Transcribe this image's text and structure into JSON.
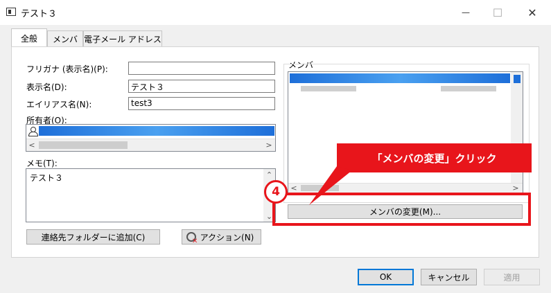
{
  "window": {
    "title": "テスト３",
    "minimize": "—",
    "maximize": "☐",
    "close": "✕"
  },
  "tabs": [
    {
      "label": "全般"
    },
    {
      "label": "メンバ"
    },
    {
      "label": "電子メール アドレス"
    }
  ],
  "form": {
    "furigana_label": "フリガナ (表示名)(P):",
    "furigana_value": "",
    "display_label": "表示名(D):",
    "display_value": "テスト３",
    "alias_label": "エイリアス名(N):",
    "alias_value": "test3",
    "owner_label": "所有者(O):",
    "memo_label": "メモ(T):",
    "memo_value": "テスト３"
  },
  "members": {
    "group_label": "メンバ",
    "change_button": "メンバの変更(M)..."
  },
  "buttons": {
    "add_contacts": "連絡先フォルダーに追加(C)",
    "action": "アクション(N)",
    "ok": "OK",
    "cancel": "キャンセル",
    "apply": "適用"
  },
  "annotation": {
    "callout_text": "「メンバの変更」クリック",
    "step_number": "4",
    "color": "#e8151b"
  },
  "icons": {
    "contact_card": "contact-card-icon",
    "person": "person-icon",
    "action": "action-icon"
  }
}
